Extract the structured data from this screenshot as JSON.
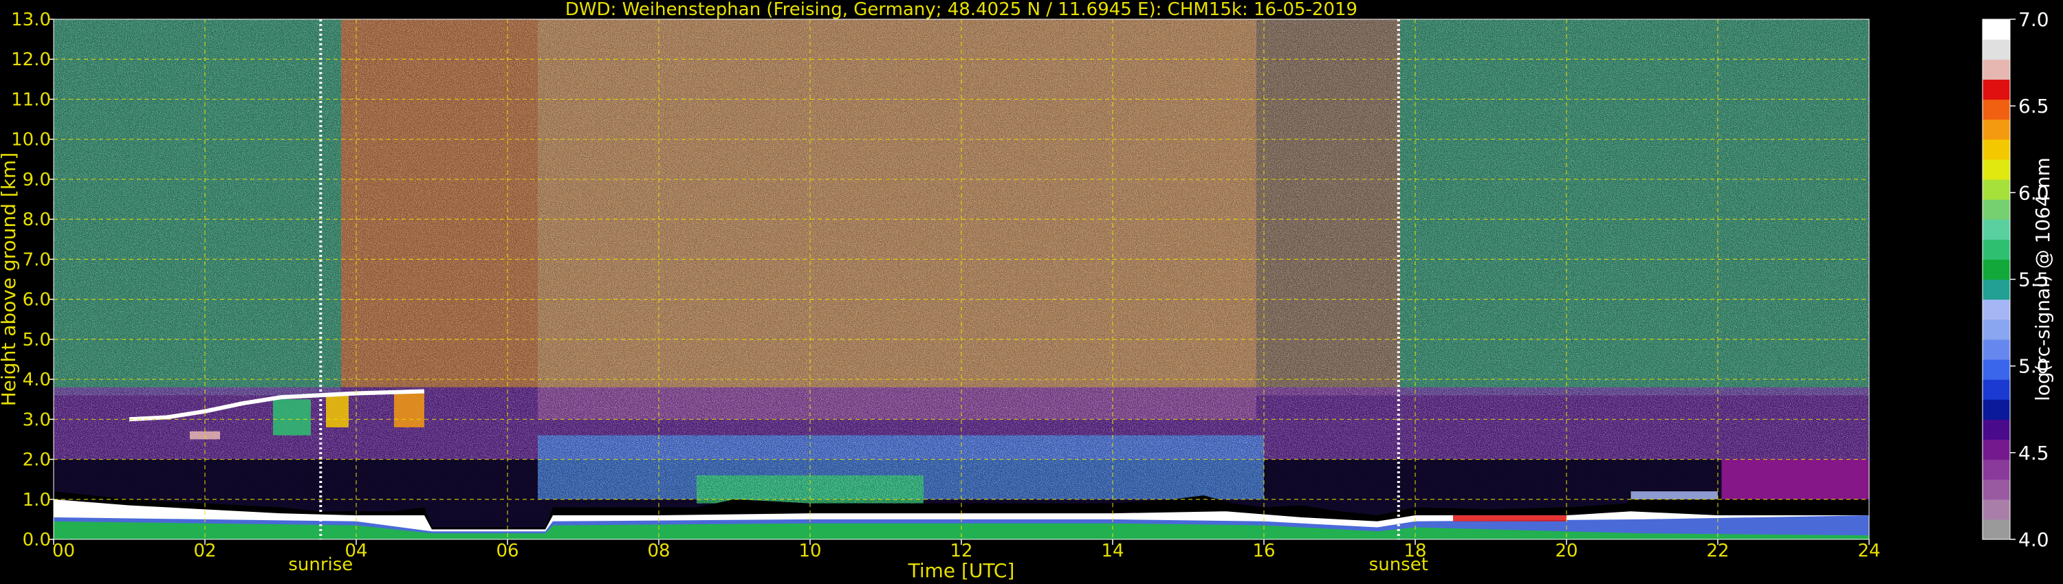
{
  "chart_data": {
    "type": "heatmap",
    "title": "DWD: Weihenstephan (Freising, Germany; 48.4025 N / 11.6945 E):    CHM15k: 16-05-2019",
    "xlabel": "Time [UTC]",
    "ylabel": "Height above ground [km]",
    "xlim": [
      0,
      24
    ],
    "ylim": [
      0,
      13
    ],
    "grid": true,
    "x_ticks": [
      {
        "value": 0,
        "label": "00"
      },
      {
        "value": 2,
        "label": "02"
      },
      {
        "value": 4,
        "label": "04"
      },
      {
        "value": 6,
        "label": "06"
      },
      {
        "value": 8,
        "label": "08"
      },
      {
        "value": 10,
        "label": "10"
      },
      {
        "value": 12,
        "label": "12"
      },
      {
        "value": 14,
        "label": "14"
      },
      {
        "value": 16,
        "label": "16"
      },
      {
        "value": 18,
        "label": "18"
      },
      {
        "value": 20,
        "label": "20"
      },
      {
        "value": 22,
        "label": "22"
      },
      {
        "value": 24,
        "label": "24"
      }
    ],
    "y_ticks": [
      {
        "value": 0,
        "label": "0.0"
      },
      {
        "value": 1,
        "label": "1.0"
      },
      {
        "value": 2,
        "label": "2.0"
      },
      {
        "value": 3,
        "label": "3.0"
      },
      {
        "value": 4,
        "label": "4.0"
      },
      {
        "value": 5,
        "label": "5.0"
      },
      {
        "value": 6,
        "label": "6.0"
      },
      {
        "value": 7,
        "label": "7.0"
      },
      {
        "value": 8,
        "label": "8.0"
      },
      {
        "value": 9,
        "label": "9.0"
      },
      {
        "value": 10,
        "label": "10.0"
      },
      {
        "value": 11,
        "label": "11.0"
      },
      {
        "value": 12,
        "label": "12.0"
      },
      {
        "value": 13,
        "label": "13.0"
      }
    ],
    "annotations": [
      {
        "label": "sunrise",
        "x": 3.53
      },
      {
        "label": "sunset",
        "x": 17.78
      }
    ],
    "colorbar": {
      "label": "log(rc-signal) @ 1064 nm",
      "range": [
        4.0,
        7.0
      ],
      "ticks": [
        {
          "value": 4.0,
          "label": "4.0"
        },
        {
          "value": 4.5,
          "label": "4.5"
        },
        {
          "value": 5.0,
          "label": "5.0"
        },
        {
          "value": 5.5,
          "label": "5.5"
        },
        {
          "value": 6.0,
          "label": "6.0"
        },
        {
          "value": 6.5,
          "label": "6.5"
        },
        {
          "value": 7.0,
          "label": "7.0"
        }
      ],
      "colors": [
        "#9a9a9a",
        "#a97fa9",
        "#9a5aa2",
        "#8a3a9a",
        "#741a8e",
        "#4a0a8c",
        "#0a1a9a",
        "#1a3ad2",
        "#3a66ec",
        "#6688ee",
        "#8aa6f0",
        "#a6b6f4",
        "#22a094",
        "#13a83a",
        "#2ec070",
        "#5ad0a0",
        "#76d070",
        "#a6e03a",
        "#e0e810",
        "#f4c800",
        "#f49a10",
        "#f06010",
        "#e01010",
        "#e6b6b0",
        "#e0e0e0",
        "#ffffff"
      ]
    },
    "layers": {
      "noise_field": [
        {
          "x0": 0,
          "x1": 3.8,
          "y0": 3.6,
          "y1": 13,
          "color": "#3aa878"
        },
        {
          "x0": 3.8,
          "x1": 6.4,
          "y0": 3.8,
          "y1": 13,
          "color": "#d08040"
        },
        {
          "x0": 6.4,
          "x1": 15.9,
          "y0": 3.0,
          "y1": 13,
          "color": "#d8a060"
        },
        {
          "x0": 15.9,
          "x1": 17.8,
          "y0": 3.6,
          "y1": 13,
          "color": "#9a8060"
        },
        {
          "x0": 17.8,
          "x1": 24,
          "y0": 3.6,
          "y1": 13,
          "color": "#3aa878"
        },
        {
          "x0": 0,
          "x1": 24,
          "y0": 2.0,
          "y1": 3.8,
          "color": "#6a2a9a"
        },
        {
          "x0": 6.4,
          "x1": 16.0,
          "y0": 1.0,
          "y1": 2.6,
          "color": "#3a7ad8"
        },
        {
          "x0": 8.5,
          "x1": 11.5,
          "y0": 0.9,
          "y1": 1.6,
          "color": "#22c060"
        }
      ],
      "boundary_layer_top": {
        "color": "#000000",
        "points": [
          [
            0,
            1.2
          ],
          [
            0.5,
            1.1
          ],
          [
            1.0,
            1.0
          ],
          [
            2.0,
            0.9
          ],
          [
            3.0,
            0.8
          ],
          [
            3.5,
            0.7
          ],
          [
            4.5,
            0.7
          ],
          [
            4.9,
            0.8
          ],
          [
            5.0,
            0.3
          ],
          [
            6.5,
            0.3
          ],
          [
            6.6,
            0.8
          ],
          [
            7.5,
            0.8
          ],
          [
            8.5,
            0.8
          ],
          [
            9.0,
            1.0
          ],
          [
            10.0,
            0.9
          ],
          [
            11.0,
            0.9
          ],
          [
            12.0,
            0.9
          ],
          [
            13.0,
            0.9
          ],
          [
            14.0,
            0.9
          ],
          [
            14.8,
            1.0
          ],
          [
            15.2,
            1.1
          ],
          [
            15.6,
            0.9
          ],
          [
            16.0,
            0.8
          ],
          [
            16.5,
            0.85
          ],
          [
            17.0,
            0.7
          ],
          [
            17.5,
            0.6
          ],
          [
            18.0,
            0.8
          ],
          [
            19.0,
            0.75
          ],
          [
            20.0,
            0.8
          ],
          [
            20.8,
            0.9
          ],
          [
            20.85,
            1.2
          ],
          [
            22.0,
            1.2
          ],
          [
            22.05,
            1.0
          ],
          [
            24.0,
            1.0
          ]
        ]
      },
      "white_band": {
        "color": "#ffffff",
        "points": [
          [
            0,
            1.0
          ],
          [
            1.0,
            0.85
          ],
          [
            2.0,
            0.75
          ],
          [
            3.0,
            0.65
          ],
          [
            4.0,
            0.6
          ],
          [
            4.9,
            0.6
          ],
          [
            5.0,
            0.25
          ],
          [
            6.5,
            0.25
          ],
          [
            6.6,
            0.6
          ],
          [
            8.0,
            0.6
          ],
          [
            10.0,
            0.65
          ],
          [
            12.0,
            0.65
          ],
          [
            14.0,
            0.65
          ],
          [
            15.5,
            0.7
          ],
          [
            16.5,
            0.55
          ],
          [
            17.5,
            0.45
          ],
          [
            18.0,
            0.6
          ],
          [
            20.0,
            0.6
          ],
          [
            20.85,
            0.7
          ],
          [
            22.0,
            0.6
          ],
          [
            24.0,
            0.6
          ]
        ]
      },
      "surface_layer": {
        "color": "#4a6ad8",
        "points": [
          [
            0,
            0.55
          ],
          [
            2.0,
            0.5
          ],
          [
            4.0,
            0.45
          ],
          [
            5.0,
            0.2
          ],
          [
            6.5,
            0.2
          ],
          [
            6.6,
            0.45
          ],
          [
            10.0,
            0.5
          ],
          [
            14.0,
            0.5
          ],
          [
            16.0,
            0.45
          ],
          [
            17.5,
            0.3
          ],
          [
            18.0,
            0.45
          ],
          [
            21.0,
            0.5
          ],
          [
            24.0,
            0.6
          ]
        ]
      },
      "green_layer": {
        "color": "#22b050",
        "points": [
          [
            0,
            0.45
          ],
          [
            2.0,
            0.4
          ],
          [
            4.0,
            0.35
          ],
          [
            5.0,
            0.15
          ],
          [
            6.5,
            0.15
          ],
          [
            6.6,
            0.35
          ],
          [
            10.0,
            0.4
          ],
          [
            14.0,
            0.4
          ],
          [
            16.0,
            0.35
          ],
          [
            17.5,
            0.2
          ],
          [
            18.0,
            0.3
          ],
          [
            21.0,
            0.15
          ],
          [
            24.0,
            0.1
          ]
        ]
      },
      "elevated_cloud": {
        "color": "#ffffff",
        "points": [
          [
            1.0,
            3.0
          ],
          [
            1.5,
            3.05
          ],
          [
            2.0,
            3.2
          ],
          [
            2.5,
            3.4
          ],
          [
            3.0,
            3.55
          ],
          [
            3.5,
            3.6
          ],
          [
            4.0,
            3.65
          ],
          [
            4.9,
            3.7
          ]
        ]
      },
      "cloud_patches": [
        {
          "x0": 2.9,
          "x1": 3.4,
          "y0": 2.6,
          "y1": 3.5,
          "color": "#2ec070"
        },
        {
          "x0": 3.6,
          "x1": 3.9,
          "y0": 2.8,
          "y1": 3.6,
          "color": "#f4c800"
        },
        {
          "x0": 4.5,
          "x1": 4.9,
          "y0": 2.8,
          "y1": 3.7,
          "color": "#f49a10"
        },
        {
          "x0": 1.8,
          "x1": 2.2,
          "y0": 2.5,
          "y1": 2.7,
          "color": "#e6b6b0"
        },
        {
          "x0": 18.5,
          "x1": 20.0,
          "y0": 0.45,
          "y1": 0.6,
          "color": "#e01010"
        },
        {
          "x0": 20.85,
          "x1": 22.0,
          "y0": 1.0,
          "y1": 1.2,
          "color": "#a6b6f4"
        },
        {
          "x0": 22.05,
          "x1": 24.0,
          "y0": 1.0,
          "y1": 2.0,
          "color": "#9a1a9a"
        }
      ]
    }
  }
}
